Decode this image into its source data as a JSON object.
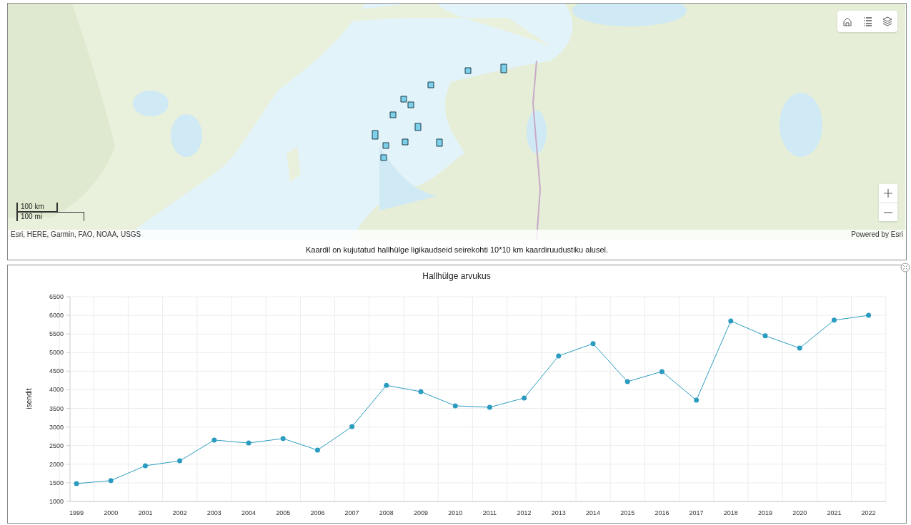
{
  "map": {
    "widgets": [
      {
        "kind": "home"
      },
      {
        "kind": "legend"
      },
      {
        "kind": "layers"
      }
    ],
    "zoom": [
      {
        "kind": "in"
      },
      {
        "kind": "out"
      }
    ],
    "scale": [
      "100 km",
      "100 mi"
    ],
    "attribution": "Esri, HERE, Garmin, FAO, NOAA, USGS",
    "powered_by": "Powered by Esri",
    "caption": "Kaardil on kujutatud hallhülge ligikaudseid seirekohti 10*10 km kaardiruudustiku alusel."
  },
  "chart": {
    "chart_data": {
      "type": "line",
      "title": "Hallhülge arvukus",
      "ylabel": "isendit",
      "categories": [
        "1999",
        "2000",
        "2001",
        "2002",
        "2003",
        "2004",
        "2005",
        "2006",
        "2007",
        "2008",
        "2009",
        "2010",
        "2011",
        "2012",
        "2013",
        "2014",
        "2015",
        "2016",
        "2017",
        "2018",
        "2019",
        "2020",
        "2021",
        "2022"
      ],
      "grid": true,
      "series": [
        {
          "color": "#2b9cc0",
          "marker": true,
          "values": [
            1480,
            1560,
            1960,
            2090,
            2650,
            2570,
            2690,
            2380,
            3010,
            4120,
            3950,
            3570,
            3530,
            3780,
            4910,
            5240,
            4220,
            4490,
            3720,
            5850,
            5450,
            5120,
            5870,
            6000
          ]
        }
      ],
      "ylim": [
        1000,
        6500
      ],
      "yticks": [
        1000,
        1500,
        2000,
        2500,
        3000,
        3500,
        4000,
        4500,
        5000,
        5500,
        6000,
        6500
      ]
    }
  }
}
